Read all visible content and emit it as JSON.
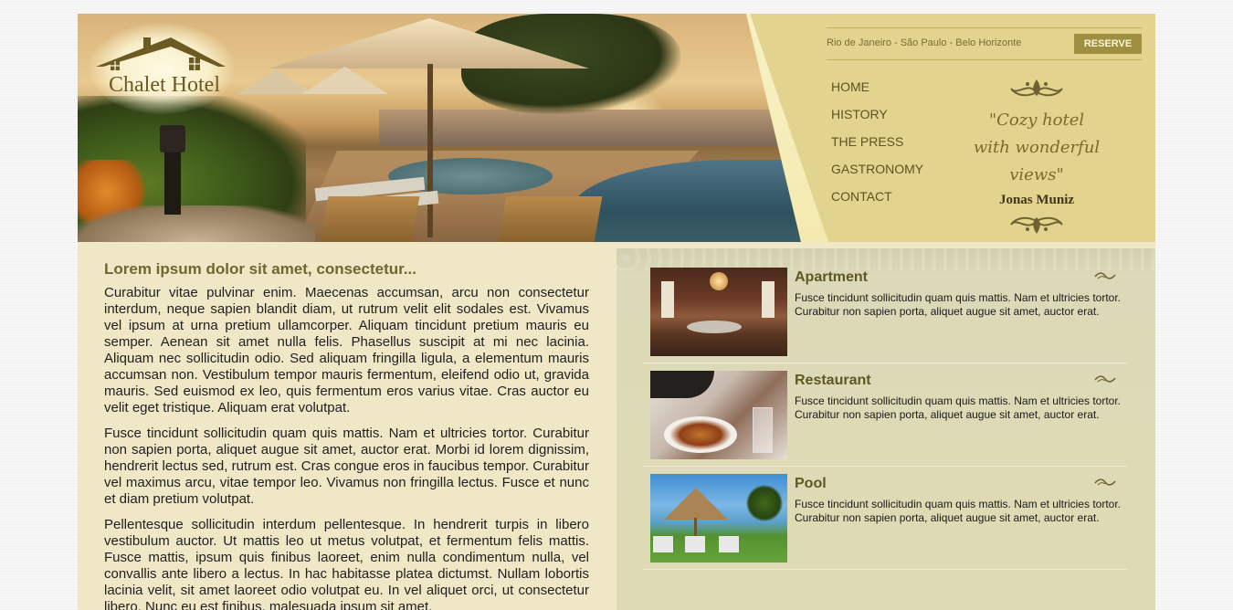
{
  "brand": {
    "name": "Chalet Hotel"
  },
  "header": {
    "cities": "Rio de Janeiro - São Paulo - Belo Horizonte",
    "reserve_label": "RESERVE",
    "nav": [
      "HOME",
      "HISTORY",
      "THE PRESS",
      "GASTRONOMY",
      "CONTACT"
    ],
    "quote": "\"Cozy hotel with wonderful views\"",
    "quote_author": "Jonas Muniz"
  },
  "article": {
    "title": "Lorem ipsum dolor sit amet, consectetur...",
    "paragraphs": [
      "Curabitur vitae pulvinar enim. Maecenas accumsan, arcu non consectetur interdum, neque sapien blandit diam, ut rutrum velit elit sodales est. Vivamus vel ipsum at urna pretium ullamcorper. Aliquam tincidunt pretium mauris eu semper. Aenean sit amet nulla felis. Phasellus suscipit at mi nec lacinia. Aliquam nec sollicitudin odio. Sed aliquam fringilla ligula, a elementum mauris accumsan non. Vestibulum tempor mauris fermentum, eleifend odio ut, gravida mauris. Sed euismod ex leo, quis fermentum eros varius vitae. Cras auctor eu velit eget tristique. Aliquam erat volutpat.",
      "Fusce tincidunt sollicitudin quam quis mattis. Nam et ultricies tortor. Curabitur non sapien porta, aliquet augue sit amet, auctor erat. Morbi id lorem dignissim, hendrerit lectus sed, rutrum est. Cras congue eros in faucibus tempor. Curabitur vel maximus arcu, vitae tempor leo. Vivamus non fringilla lectus. Fusce et nunc et diam pretium volutpat.",
      "Pellentesque sollicitudin interdum pellentesque. In hendrerit turpis in libero vestibulum auctor. Ut mattis leo ut metus volutpat, et fermentum felis mattis. Fusce mattis, ipsum quis finibus laoreet, enim nulla condimentum nulla, vel convallis ante libero a lectus. In hac habitasse platea dictumst. Nullam lobortis lacinia velit, sit amet laoreet odio volutpat eu. In vel aliquet orci, ut consectetur libero. Nunc eu est finibus, malesuada ipsum sit amet,"
    ]
  },
  "features": [
    {
      "title": "Apartment",
      "text": "Fusce tincidunt sollicitudin quam quis mattis. Nam et ultricies tortor. Curabitur non sapien porta, aliquet augue sit amet, auctor erat."
    },
    {
      "title": "Restaurant",
      "text": "Fusce tincidunt sollicitudin quam quis mattis. Nam et ultricies tortor. Curabitur non sapien porta, aliquet augue sit amet, auctor erat."
    },
    {
      "title": "Pool",
      "text": "Fusce tincidunt sollicitudin quam quis mattis. Nam et ultricies tortor. Curabitur non sapien porta, aliquet augue sit amet, auctor erat."
    }
  ],
  "colors": {
    "header_bg": "#e2d48f",
    "content_bg": "#efe7c6",
    "reserve_button": "#9f8f40",
    "title_olive": "#6e6730"
  },
  "icons": [
    "house-roof-logo-icon",
    "flourish-ornament-icon",
    "tilde-swirl-icon"
  ]
}
